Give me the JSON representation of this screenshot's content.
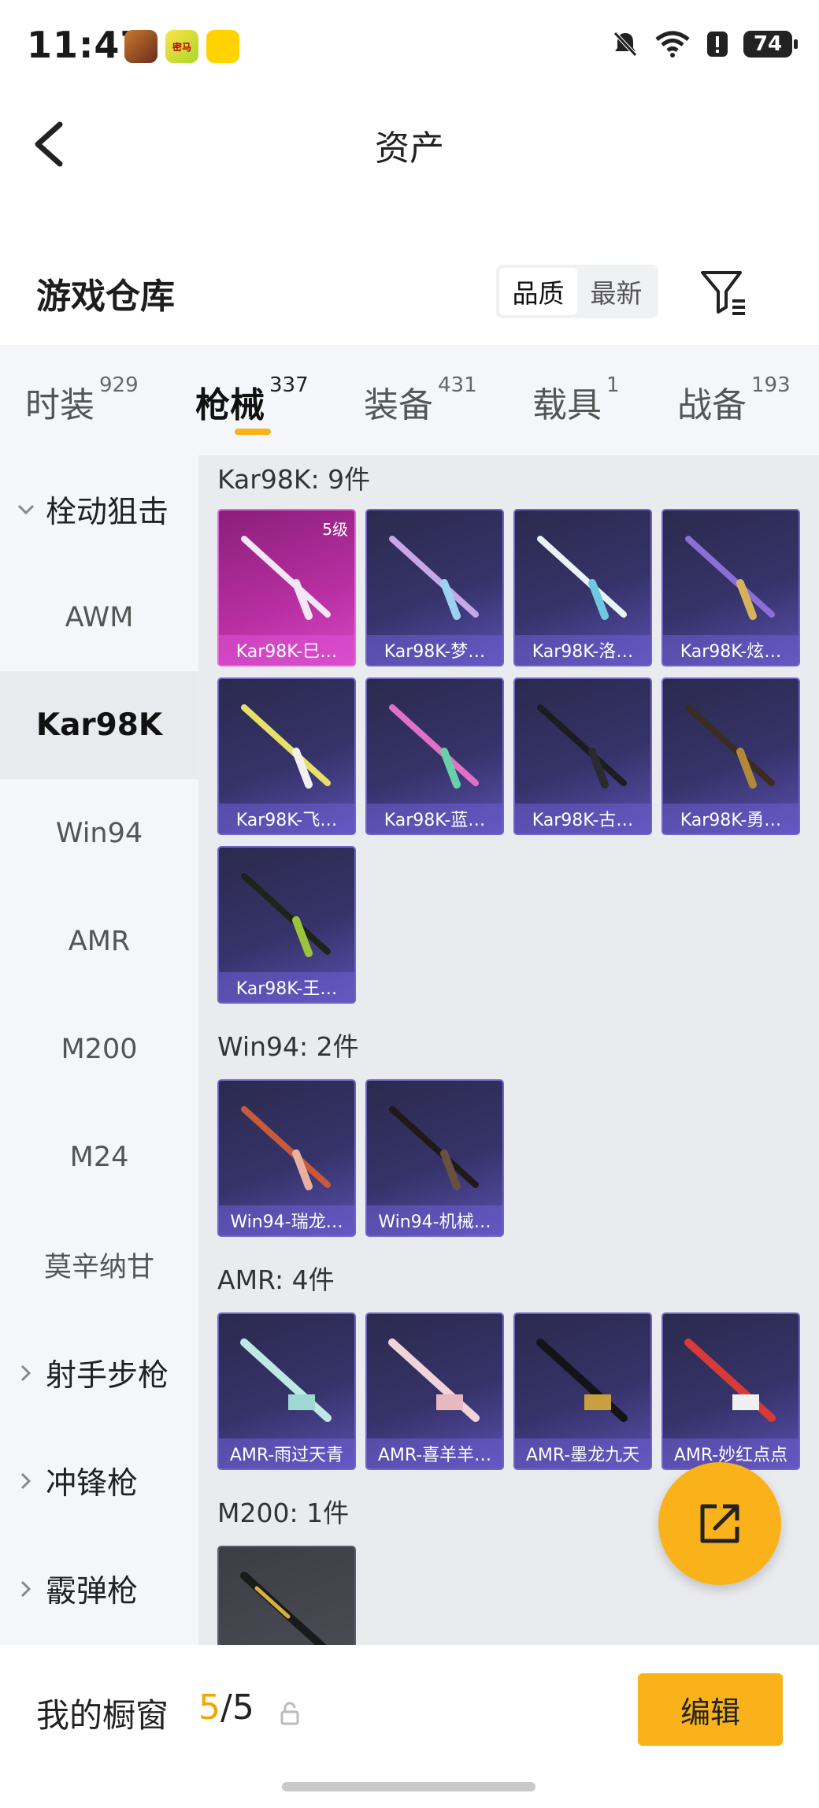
{
  "status_bar": {
    "time": "11:47",
    "battery": "74",
    "app_icons": [
      "game-avatar-icon",
      "mima-app-icon",
      "game-app-icon"
    ],
    "mima_label": "密马"
  },
  "nav": {
    "title": "资产"
  },
  "header": {
    "title": "游戏仓库",
    "sort_options": [
      "品质",
      "最新"
    ],
    "sort_active": "品质"
  },
  "tabs": [
    {
      "label": "时装",
      "count": "929"
    },
    {
      "label": "枪械",
      "count": "337",
      "active": true
    },
    {
      "label": "装备",
      "count": "431"
    },
    {
      "label": "载具",
      "count": "1"
    },
    {
      "label": "战备",
      "count": "193"
    }
  ],
  "sidebar": {
    "items": [
      {
        "label": "栓动狙击",
        "type": "group",
        "expanded": true
      },
      {
        "label": "AWM"
      },
      {
        "label": "Kar98K",
        "active": true
      },
      {
        "label": "Win94"
      },
      {
        "label": "AMR"
      },
      {
        "label": "M200"
      },
      {
        "label": "M24"
      },
      {
        "label": "莫辛纳甘"
      },
      {
        "label": "射手步枪",
        "type": "group"
      },
      {
        "label": "冲锋枪",
        "type": "group"
      },
      {
        "label": "霰弹枪",
        "type": "group"
      }
    ]
  },
  "groups": [
    {
      "label": "Kar98K: 9件",
      "items": [
        {
          "name": "Kar98K-巳…",
          "level": "5级"
        },
        {
          "name": "Kar98K-梦…"
        },
        {
          "name": "Kar98K-洛…"
        },
        {
          "name": "Kar98K-炫…"
        },
        {
          "name": "Kar98K-飞…"
        },
        {
          "name": "Kar98K-蓝…"
        },
        {
          "name": "Kar98K-古…"
        },
        {
          "name": "Kar98K-勇…"
        },
        {
          "name": "Kar98K-王…"
        }
      ]
    },
    {
      "label": "Win94: 2件",
      "items": [
        {
          "name": "Win94-瑞龙…"
        },
        {
          "name": "Win94-机械…"
        }
      ]
    },
    {
      "label": "AMR: 4件",
      "items": [
        {
          "name": "AMR-雨过天青"
        },
        {
          "name": "AMR-喜羊羊…"
        },
        {
          "name": "AMR-墨龙九天"
        },
        {
          "name": "AMR-妙红点点"
        }
      ]
    },
    {
      "label": "M200: 1件",
      "items": [
        {
          "name": ""
        }
      ]
    }
  ],
  "bottom_bar": {
    "label": "我的橱窗",
    "count_current": "5",
    "count_separator": "/",
    "count_total": "5",
    "edit_label": "编辑"
  },
  "colors": {
    "accent": "#f9b21a",
    "card_purple": "#36336a",
    "card_pink": "#b92fa3"
  }
}
